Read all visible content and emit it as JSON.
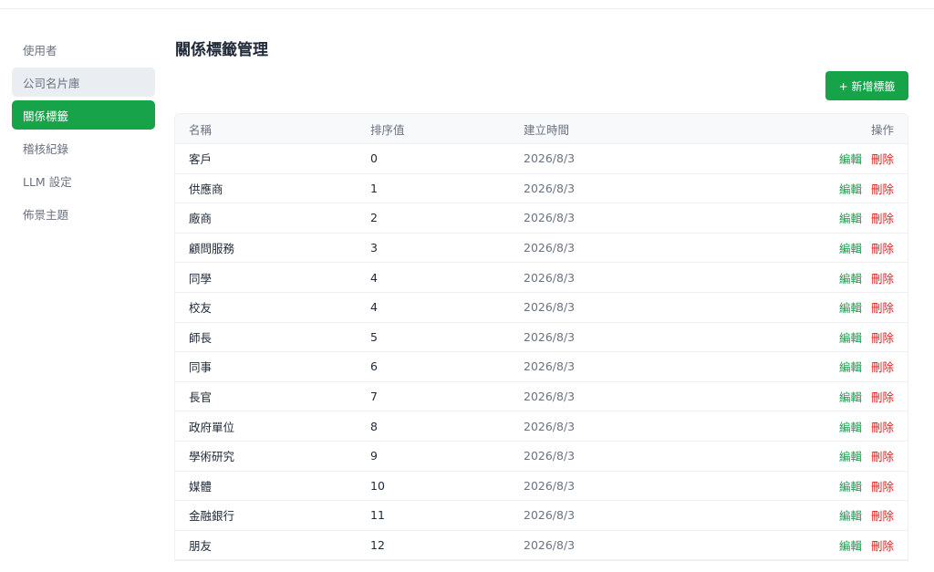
{
  "sidebar": {
    "items": [
      {
        "label": "使用者"
      },
      {
        "label": "公司名片庫"
      },
      {
        "label": "關係標籤"
      },
      {
        "label": "稽核紀錄"
      },
      {
        "label": "LLM 設定"
      },
      {
        "label": "佈景主題"
      }
    ]
  },
  "page": {
    "title": "關係標籤管理",
    "add_button": "+ 新增標籤"
  },
  "table": {
    "headers": {
      "name": "名稱",
      "sort": "排序值",
      "created": "建立時間",
      "actions": "操作"
    },
    "edit_label": "編輯",
    "delete_label": "刪除",
    "rows": [
      {
        "name": "客戶",
        "sort": "0",
        "created": "2026/8/3"
      },
      {
        "name": "供應商",
        "sort": "1",
        "created": "2026/8/3"
      },
      {
        "name": "廠商",
        "sort": "2",
        "created": "2026/8/3"
      },
      {
        "name": "顧問服務",
        "sort": "3",
        "created": "2026/8/3"
      },
      {
        "name": "同學",
        "sort": "4",
        "created": "2026/8/3"
      },
      {
        "name": "校友",
        "sort": "4",
        "created": "2026/8/3"
      },
      {
        "name": "師長",
        "sort": "5",
        "created": "2026/8/3"
      },
      {
        "name": "同事",
        "sort": "6",
        "created": "2026/8/3"
      },
      {
        "name": "長官",
        "sort": "7",
        "created": "2026/8/3"
      },
      {
        "name": "政府單位",
        "sort": "8",
        "created": "2026/8/3"
      },
      {
        "name": "學術研究",
        "sort": "9",
        "created": "2026/8/3"
      },
      {
        "name": "媒體",
        "sort": "10",
        "created": "2026/8/3"
      },
      {
        "name": "金融銀行",
        "sort": "11",
        "created": "2026/8/3"
      },
      {
        "name": "朋友",
        "sort": "12",
        "created": "2026/8/3"
      }
    ]
  }
}
